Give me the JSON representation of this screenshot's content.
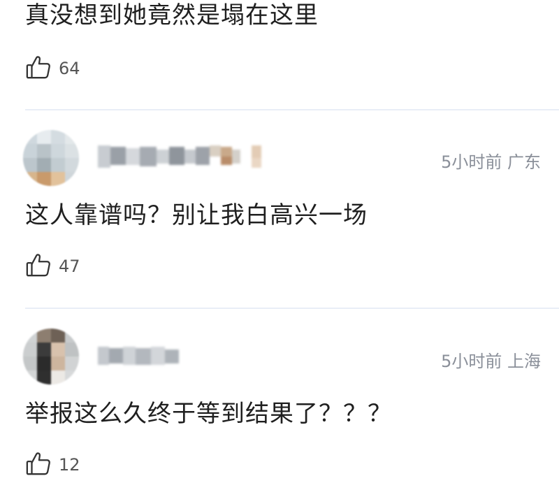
{
  "comments": [
    {
      "text": "真没想到她竟然是塌在这里",
      "likes": "64"
    },
    {
      "meta": "5小时前 广东",
      "text": "这人靠谱吗？别让我白高兴一场",
      "likes": "47"
    },
    {
      "meta": "5小时前 上海",
      "text": "举报这么久终于等到结果了？？？",
      "likes": "12"
    }
  ],
  "icons": {
    "like": "thumbs-up-icon"
  },
  "colors": {
    "text": "#1f1f1f",
    "meta": "#8a8f99",
    "divider": "#e9eef7"
  }
}
